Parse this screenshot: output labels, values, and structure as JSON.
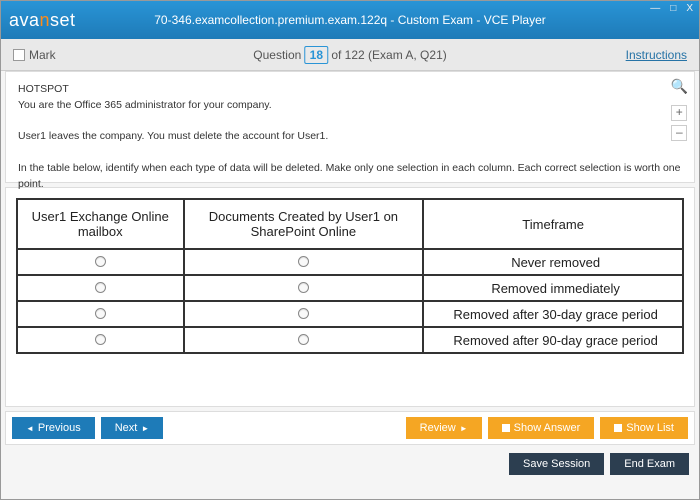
{
  "window": {
    "logo_pre": "ava",
    "logo_accent": "n",
    "logo_post": "set",
    "title": "70-346.examcollection.premium.exam.122q - Custom Exam - VCE Player",
    "minimize": "—",
    "maximize": "□",
    "close": "X"
  },
  "header": {
    "mark": "Mark",
    "q_word": "Question",
    "q_num": "18",
    "q_rest": " of 122 (Exam A, Q21)",
    "instructions": "Instructions"
  },
  "question": {
    "tag": "HOTSPOT",
    "line1": "You are the Office 365 administrator for your company.",
    "line2": "User1 leaves the company. You must delete the account for User1.",
    "line3": "In the table below, identify when each type of data will be deleted. Make only one selection in each column. Each correct selection is worth one point."
  },
  "hotspot": {
    "col1": "User1 Exchange Online mailbox",
    "col2": "Documents Created by User1 on SharePoint Online",
    "col3": "Timeframe",
    "rows": [
      "Never removed",
      "Removed immediately",
      "Removed after 30-day grace period",
      "Removed after 90-day grace period"
    ]
  },
  "zoom": {
    "plus": "+",
    "minus": "–"
  },
  "nav": {
    "previous": "Previous",
    "next": "Next",
    "review": "Review",
    "show_answer": "Show Answer",
    "show_list": "Show List"
  },
  "bottom": {
    "save": "Save Session",
    "end": "End Exam"
  }
}
